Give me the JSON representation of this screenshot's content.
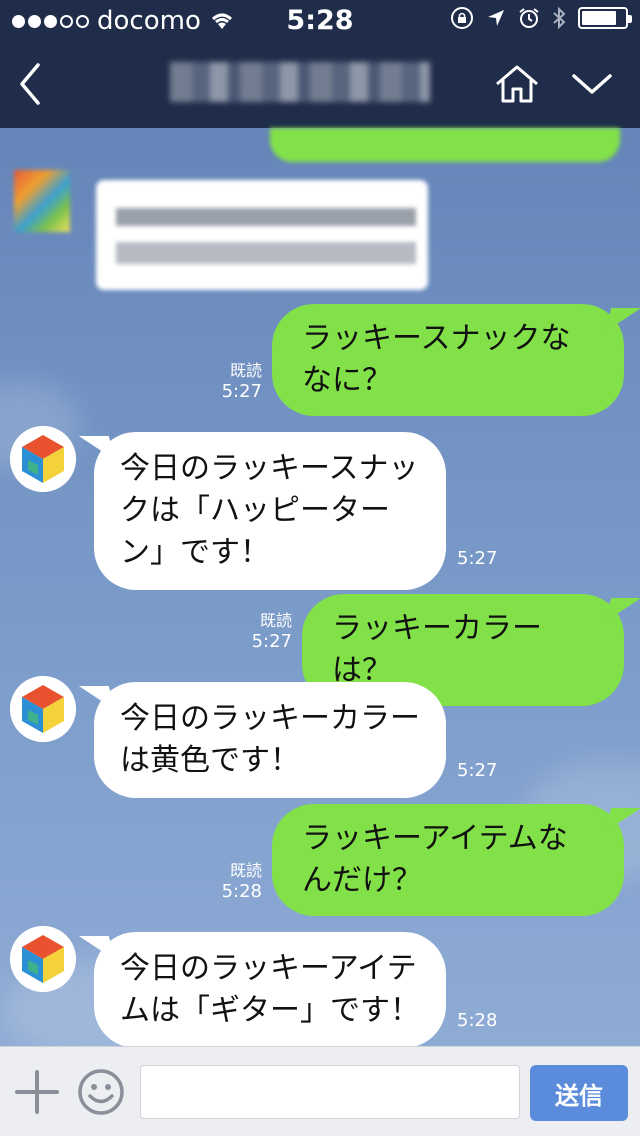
{
  "status_bar": {
    "carrier": "docomo",
    "time": "5:28",
    "signal_dots_filled": 3,
    "signal_dots_total": 5,
    "battery_level": 0.75
  },
  "navbar": {
    "back_icon": "chevron-left-icon",
    "home_icon": "home-icon",
    "menu_icon": "chevron-down-icon"
  },
  "messages": [
    {
      "dir": "out",
      "text": "ラッキースナックななに？",
      "read": "既読",
      "time": "5:27"
    },
    {
      "dir": "in",
      "text": "今日のラッキースナックは「ハッピーターン」です！",
      "time": "5:27"
    },
    {
      "dir": "out",
      "text": "ラッキーカラーは？",
      "read": "既読",
      "time": "5:27"
    },
    {
      "dir": "in",
      "text": "今日のラッキーカラーは黄色です！",
      "time": "5:27"
    },
    {
      "dir": "out",
      "text": "ラッキーアイテムなんだけ？",
      "read": "既読",
      "time": "5:28"
    },
    {
      "dir": "in",
      "text": "今日のラッキーアイテムは「ギター」です！",
      "time": "5:28"
    }
  ],
  "input": {
    "plus_icon": "plus-icon",
    "emoji_icon": "smiley-icon",
    "send_label": "送信"
  },
  "colors": {
    "header": "#1f2d4a",
    "bubble_out": "#82e048",
    "bubble_in": "#ffffff",
    "send_button": "#5b8cdc",
    "input_bar": "#eceef2"
  }
}
